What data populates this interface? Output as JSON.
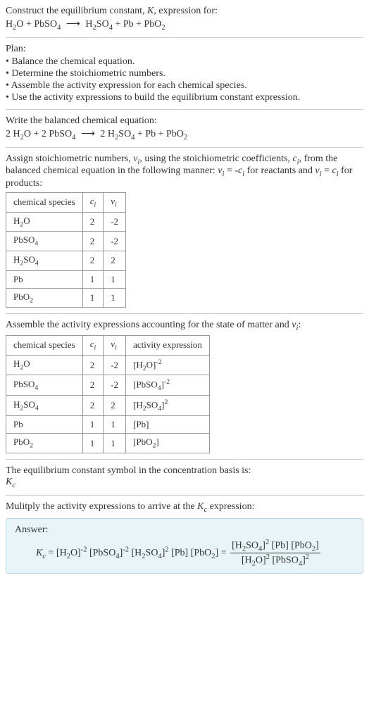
{
  "intro": {
    "line1": "Construct the equilibrium constant, K, expression for:",
    "equation": "H₂O + PbSO₄ ⟶ H₂SO₄ + Pb + PbO₂"
  },
  "plan": {
    "title": "Plan:",
    "items": [
      "• Balance the chemical equation.",
      "• Determine the stoichiometric numbers.",
      "• Assemble the activity expression for each chemical species.",
      "• Use the activity expressions to build the equilibrium constant expression."
    ]
  },
  "balanced": {
    "title": "Write the balanced chemical equation:",
    "equation": "2 H₂O + 2 PbSO₄ ⟶ 2 H₂SO₄ + Pb + PbO₂"
  },
  "stoich": {
    "intro": "Assign stoichiometric numbers, νᵢ, using the stoichiometric coefficients, cᵢ, from the balanced chemical equation in the following manner: νᵢ = -cᵢ for reactants and νᵢ = cᵢ for products:",
    "headers": [
      "chemical species",
      "cᵢ",
      "νᵢ"
    ],
    "rows": [
      [
        "H₂O",
        "2",
        "-2"
      ],
      [
        "PbSO₄",
        "2",
        "-2"
      ],
      [
        "H₂SO₄",
        "2",
        "2"
      ],
      [
        "Pb",
        "1",
        "1"
      ],
      [
        "PbO₂",
        "1",
        "1"
      ]
    ]
  },
  "activity": {
    "intro": "Assemble the activity expressions accounting for the state of matter and νᵢ:",
    "headers": [
      "chemical species",
      "cᵢ",
      "νᵢ",
      "activity expression"
    ],
    "rows": [
      [
        "H₂O",
        "2",
        "-2",
        "[H₂O]⁻²"
      ],
      [
        "PbSO₄",
        "2",
        "-2",
        "[PbSO₄]⁻²"
      ],
      [
        "H₂SO₄",
        "2",
        "2",
        "[H₂SO₄]²"
      ],
      [
        "Pb",
        "1",
        "1",
        "[Pb]"
      ],
      [
        "PbO₂",
        "1",
        "1",
        "[PbO₂]"
      ]
    ]
  },
  "symbol": {
    "line1": "The equilibrium constant symbol in the concentration basis is:",
    "line2": "K_c"
  },
  "multiply": {
    "title": "Mulitply the activity expressions to arrive at the K_c expression:"
  },
  "answer": {
    "label": "Answer:",
    "lhs": "K_c = [H₂O]⁻² [PbSO₄]⁻² [H₂SO₄]² [Pb] [PbO₂] = ",
    "frac_num": "[H₂SO₄]² [Pb] [PbO₂]",
    "frac_den": "[H₂O]² [PbSO₄]²"
  }
}
